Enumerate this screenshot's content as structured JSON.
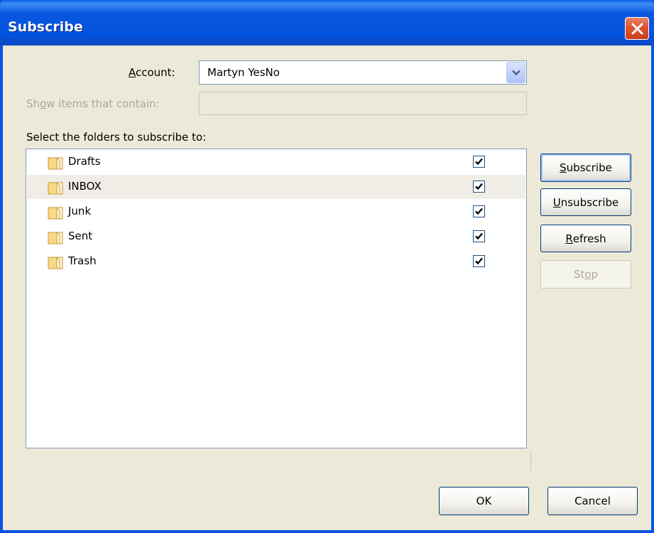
{
  "window": {
    "title": "Subscribe"
  },
  "account": {
    "label_pre": "",
    "label_ul": "A",
    "label_post": "ccount:",
    "value": "Martyn YesNo"
  },
  "filter": {
    "label_pre": "Sh",
    "label_ul": "o",
    "label_post": "w items that contain:",
    "value": ""
  },
  "list": {
    "heading": "Select the folders to subscribe to:",
    "folders": [
      {
        "name": "Drafts",
        "subscribed": true
      },
      {
        "name": "INBOX",
        "subscribed": true,
        "selected": true
      },
      {
        "name": "Junk",
        "subscribed": true
      },
      {
        "name": "Sent",
        "subscribed": true
      },
      {
        "name": "Trash",
        "subscribed": true
      }
    ]
  },
  "buttons": {
    "subscribe": {
      "ul": "S",
      "rest": "ubscribe"
    },
    "unsubscribe": {
      "ul": "U",
      "rest": "nsubscribe"
    },
    "refresh": {
      "ul": "R",
      "rest": "efresh"
    },
    "stop": {
      "pre": "St",
      "ul": "o",
      "rest": "p"
    },
    "ok": "OK",
    "cancel": "Cancel"
  },
  "colors": {
    "titlebar": "#0453dd",
    "dialog_bg": "#ece9d8",
    "close": "#e0542f",
    "selected_row": "#f0ede6"
  }
}
